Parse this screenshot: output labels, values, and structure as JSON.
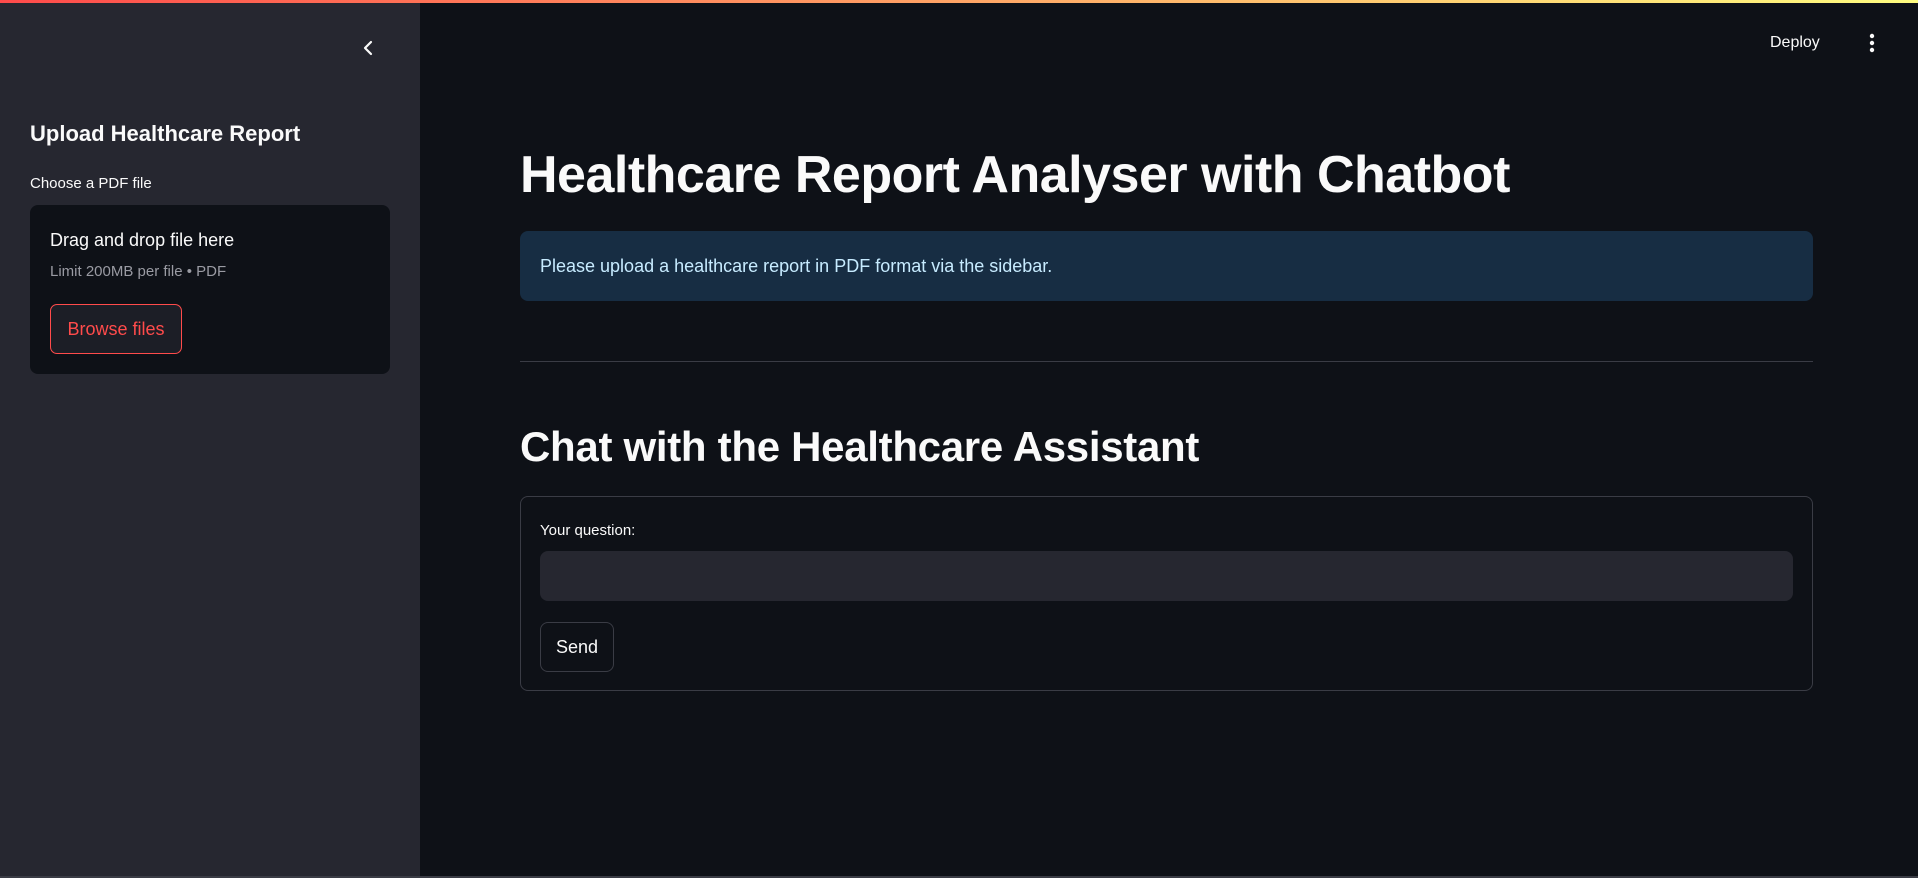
{
  "sidebar": {
    "collapse_icon": "chevron-left-icon",
    "title": "Upload Healthcare Report",
    "uploader": {
      "label": "Choose a PDF file",
      "drop_title": "Drag and drop file here",
      "drop_hint": "Limit 200MB per file • PDF",
      "browse_label": "Browse files"
    }
  },
  "header": {
    "deploy_label": "Deploy",
    "menu_icon": "vertical-dots-icon"
  },
  "main": {
    "title": "Healthcare Report Analyser with Chatbot",
    "info_message": "Please upload a healthcare report in PDF format via the sidebar.",
    "chat": {
      "section_title": "Chat with the Healthcare Assistant",
      "question_label": "Your question:",
      "question_value": "",
      "send_label": "Send"
    }
  },
  "colors": {
    "accent": "#ff4b4b",
    "background": "#0e1117",
    "sidebar_background": "#262730",
    "info_background": "#172d43",
    "info_text": "#c7ebff"
  }
}
